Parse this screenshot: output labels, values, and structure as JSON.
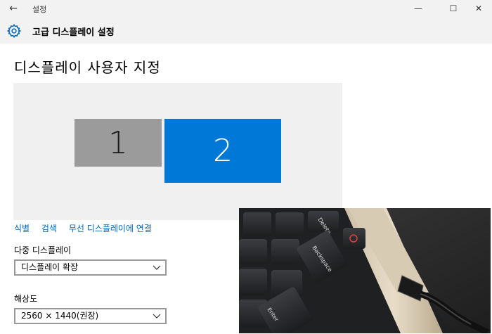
{
  "window": {
    "app_title": "설정",
    "minimize_glyph": "—",
    "maximize_glyph": "☐",
    "close_glyph": "✕",
    "back_glyph": "←"
  },
  "header": {
    "title": "고급 디스플레이 설정",
    "icon": "gear-icon"
  },
  "page": {
    "title": "디스플레이 사용자 지정"
  },
  "displays": [
    {
      "label": "1"
    },
    {
      "label": "2"
    }
  ],
  "links": {
    "identify": "식별",
    "detect": "검색",
    "wireless": "무선 디스플레이에 연결"
  },
  "multi_display": {
    "label": "다중 디스플레이",
    "value": "디스플레이 확장"
  },
  "resolution": {
    "label": "해상도",
    "value": "2560 × 1440(권장)"
  },
  "photo": {
    "keys": [
      "Delete",
      "Backspace",
      "Enter"
    ]
  },
  "colors": {
    "accent": "#0078d7",
    "link": "#0067b8",
    "monitor_inactive": "#9b9b9b"
  }
}
